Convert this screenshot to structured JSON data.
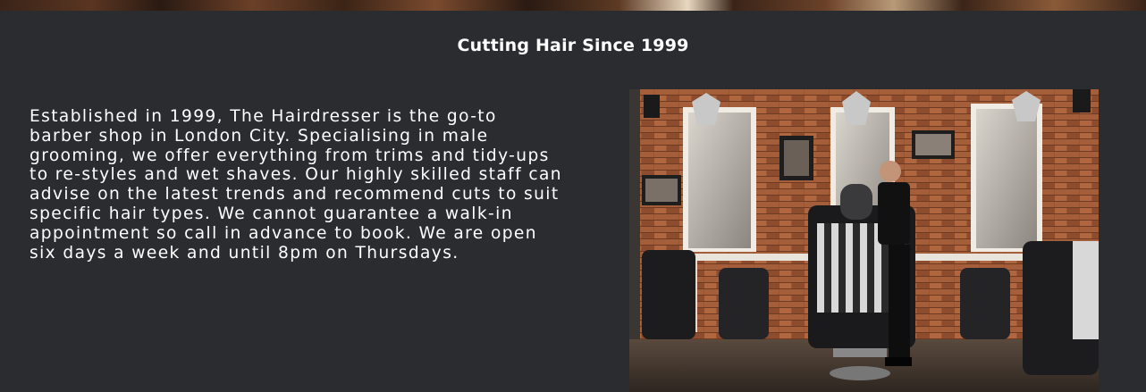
{
  "section": {
    "title": "Cutting Hair Since 1999",
    "description": "Established in 1999, The Hairdresser is the go-to barber shop in London City. Specialising in male grooming, we offer everything from trims and tidy-ups to re-styles and wet shaves. Our highly skilled staff can advise on the latest trends and recommend cuts to suit specific hair types. We cannot guarantee a walk-in appointment so call in advance to book. We are open six days a week and until 8pm on Thursdays."
  },
  "colors": {
    "background": "#2b2c30",
    "text": "#ffffff",
    "brick": "#9a5534"
  }
}
